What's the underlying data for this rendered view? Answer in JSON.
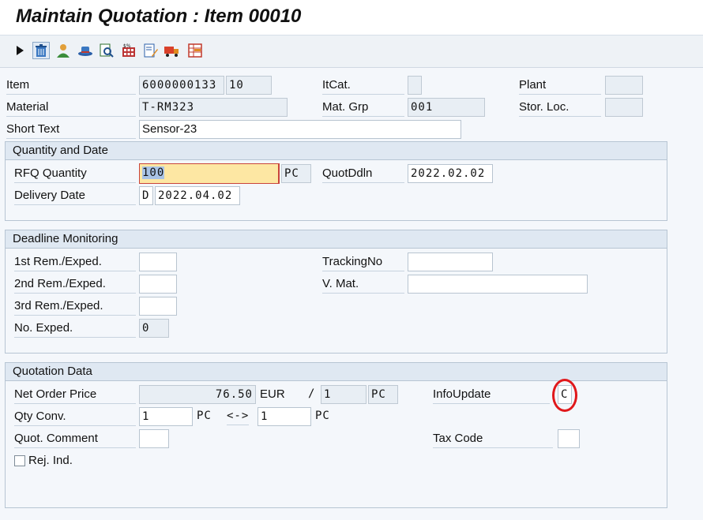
{
  "window": {
    "title": "Maintain Quotation : Item 00010"
  },
  "toolbar": {
    "buttons": [
      "play-icon",
      "trash-icon",
      "person-icon",
      "hat-icon",
      "zoom-doc-icon",
      "calculator-icon",
      "edit-doc-icon",
      "truck-icon",
      "table-icon"
    ]
  },
  "header": {
    "item_label": "Item",
    "item_number": "6000000133",
    "item_pos": "10",
    "itcat_label": "ItCat.",
    "itcat_value": "",
    "plant_label": "Plant",
    "plant_value": "",
    "material_label": "Material",
    "material_value": "T-RM323",
    "matgrp_label": "Mat. Grp",
    "matgrp_value": "001",
    "storloc_label": "Stor. Loc.",
    "storloc_value": "",
    "shorttext_label": "Short Text",
    "shorttext_value": "Sensor-23"
  },
  "quantity_date": {
    "title": "Quantity and Date",
    "rfq_label": "RFQ Quantity",
    "rfq_value": "100",
    "rfq_unit": "PC",
    "quotddln_label": "QuotDdln",
    "quotddln_value": "2022.02.02",
    "delivery_label": "Delivery Date",
    "delivery_type": "D",
    "delivery_value": "2022.04.02"
  },
  "deadline": {
    "title": "Deadline Monitoring",
    "rem1_label": "1st Rem./Exped.",
    "rem1_value": "",
    "rem2_label": "2nd Rem./Exped.",
    "rem2_value": "",
    "rem3_label": "3rd Rem./Exped.",
    "rem3_value": "",
    "noexped_label": "No. Exped.",
    "noexped_value": "0",
    "tracking_label": "TrackingNo",
    "tracking_value": "",
    "vmat_label": "V. Mat.",
    "vmat_value": ""
  },
  "quotation": {
    "title": "Quotation Data",
    "netprice_label": "Net Order Price",
    "netprice_value": "76.50",
    "currency": "EUR",
    "per_sep": "/",
    "per_value": "1",
    "per_unit": "PC",
    "infoupdate_label": "InfoUpdate",
    "infoupdate_value": "C",
    "qtyconv_label": "Qty Conv.",
    "qtyconv_left": "1",
    "qtyconv_left_unit": "PC",
    "qtyconv_arrow": "<->",
    "qtyconv_right": "1",
    "qtyconv_right_unit": "PC",
    "comment_label": "Quot. Comment",
    "comment_value": "",
    "taxcode_label": "Tax Code",
    "taxcode_value": "",
    "rejind_label": "Rej. Ind.",
    "rejind_checked": false
  },
  "colors": {
    "highlight_circle": "#e0181b",
    "focus_field": "#fde7a3"
  }
}
